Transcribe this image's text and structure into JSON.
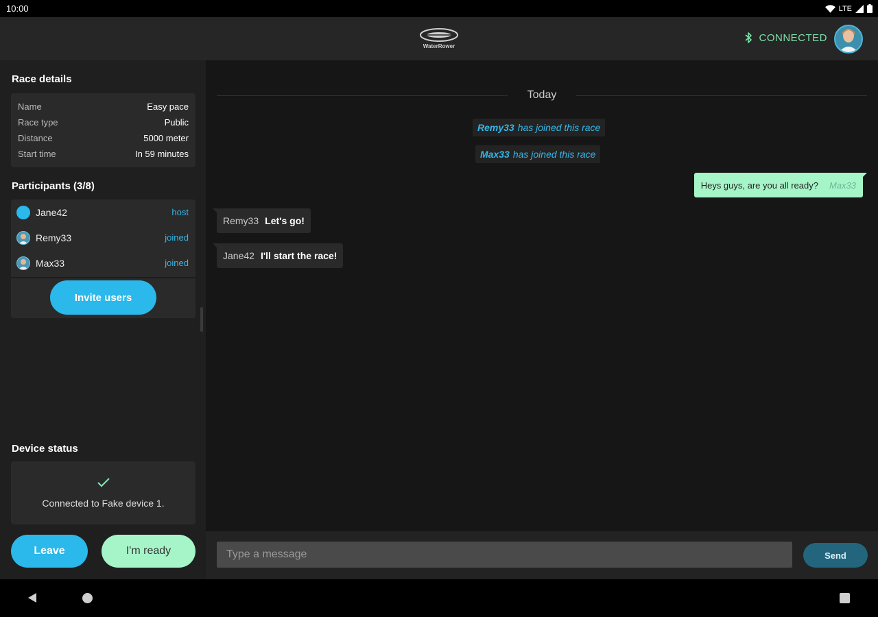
{
  "status_bar": {
    "time": "10:00",
    "network": "LTE"
  },
  "app_bar": {
    "logo_text": "WaterRower",
    "connection_label": "CONNECTED",
    "colors": {
      "connected": "#7de3aa"
    }
  },
  "race_details": {
    "title": "Race details",
    "rows": [
      {
        "key": "Name",
        "value": "Easy pace"
      },
      {
        "key": "Race type",
        "value": "Public"
      },
      {
        "key": "Distance",
        "value": "5000 meter"
      },
      {
        "key": "Start time",
        "value": "In 59 minutes"
      }
    ]
  },
  "participants": {
    "title": "Participants (3/8)",
    "items": [
      {
        "name": "Jane42",
        "role": "host",
        "avatar": "dot"
      },
      {
        "name": "Remy33",
        "role": "joined",
        "avatar": "photo"
      },
      {
        "name": "Max33",
        "role": "joined",
        "avatar": "photo"
      }
    ],
    "invite_label": "Invite users"
  },
  "device_status": {
    "title": "Device status",
    "icon": "check-icon",
    "message": "Connected to Fake device 1."
  },
  "actions": {
    "leave_label": "Leave",
    "ready_label": "I'm ready"
  },
  "chat": {
    "date_divider": "Today",
    "system_messages": [
      {
        "user": "Remy33",
        "text": "has joined this race"
      },
      {
        "user": "Max33",
        "text": "has joined this race"
      }
    ],
    "outgoing": {
      "text": "Heys guys, are you all ready?",
      "sender": "Max33"
    },
    "incoming": [
      {
        "sender": "Remy33",
        "text": "Let's go!"
      },
      {
        "sender": "Jane42",
        "text": "I'll start the race!"
      }
    ]
  },
  "composer": {
    "placeholder": "Type a message",
    "value": "",
    "send_label": "Send"
  },
  "colors": {
    "accent": "#2bb8ea",
    "mint": "#a6f5c8",
    "background": "#161616",
    "panel": "#1f1f1f"
  }
}
